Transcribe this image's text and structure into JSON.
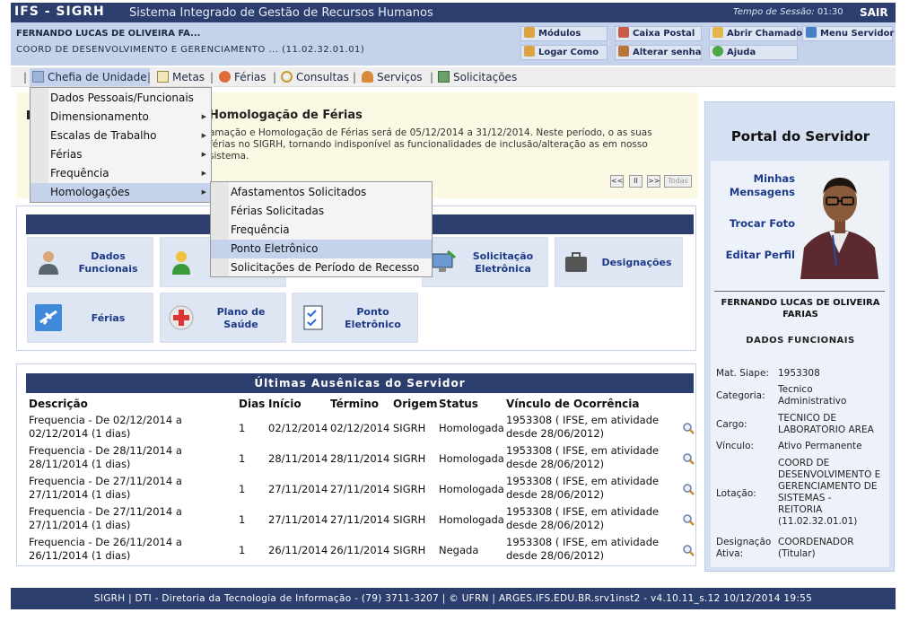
{
  "header": {
    "system_short": "IFS - SIGRH",
    "system_name": "Sistema Integrado de Gestão de Recursos Humanos",
    "session_label": "Tempo de Sessão:",
    "session_time": "01:30",
    "logout": "SAIR"
  },
  "user": {
    "name": "FERNANDO LUCAS DE OLIVEIRA FA...",
    "unit": "COORD DE DESENVOLVIMENTO E GERENCIAMENTO ... (11.02.32.01.01)"
  },
  "quick_links": {
    "modulos": "Módulos",
    "caixa_postal": "Caixa Postal",
    "abrir_chamado": "Abrir Chamado",
    "menu_servidor": "Menu Servidor",
    "logar_como": "Logar Como",
    "alterar_senha": "Alterar senha",
    "ajuda": "Ajuda"
  },
  "menu": {
    "chefia": "Chefia de Unidade",
    "metas": "Metas",
    "ferias": "Férias",
    "consultas": "Consultas",
    "servicos": "Serviços",
    "solicitacoes": "Solicitações",
    "separator": "|"
  },
  "dropdown_chefia": [
    "Dados Pessoais/Funcionais",
    "Dimensionamento",
    "Escalas de Trabalho",
    "Férias",
    "Frequência",
    "Homologações"
  ],
  "dropdown_homologacoes": [
    "Afastamentos Solicitados",
    "Férias Solicitadas",
    "Frequência",
    "Ponto Eletrônico",
    "Solicitações de Período de Recesso"
  ],
  "notice": {
    "title": "Homologação de Férias",
    "text": "amação e Homologação de Férias será de 05/12/2014 a 31/12/2014. Neste período, o as suas férias no SIGRH, tornando indisponível as funcionalidades de inclusão/alteração as em nosso sistema.",
    "pager": {
      "prev": "<<",
      "pause": "II",
      "next": ">>",
      "all": "Todas"
    }
  },
  "shortcuts": {
    "dados_funcionais": "Dados Funcionais",
    "solicitacao_eletronica": "Solicitação Eletrônica",
    "designacoes": "Designações",
    "ferias": "Férias",
    "plano_saude": "Plano de Saúde",
    "ponto_eletronico": "Ponto Eletrônico"
  },
  "absences": {
    "title": "Últimas Ausênicas do Servidor",
    "columns": [
      "Descrição",
      "Dias",
      "Início",
      "Término",
      "Origem",
      "Status",
      "Vínculo de Ocorrência"
    ],
    "rows": [
      {
        "desc1": "Frequencia - De 02/12/2014 a",
        "desc2": "02/12/2014 (1 dias)",
        "dias": "1",
        "inicio": "02/12/2014",
        "termino": "02/12/2014",
        "origem": "SIGRH",
        "status": "Homologada",
        "vinc1": "1953308 ( IFSE, em atividade",
        "vinc2": "desde 28/06/2012)"
      },
      {
        "desc1": "Frequencia - De 28/11/2014 a",
        "desc2": "28/11/2014 (1 dias)",
        "dias": "1",
        "inicio": "28/11/2014",
        "termino": "28/11/2014",
        "origem": "SIGRH",
        "status": "Homologada",
        "vinc1": "1953308 ( IFSE, em atividade",
        "vinc2": "desde 28/06/2012)"
      },
      {
        "desc1": "Frequencia - De 27/11/2014 a",
        "desc2": "27/11/2014 (1 dias)",
        "dias": "1",
        "inicio": "27/11/2014",
        "termino": "27/11/2014",
        "origem": "SIGRH",
        "status": "Homologada",
        "vinc1": "1953308 ( IFSE, em atividade",
        "vinc2": "desde 28/06/2012)"
      },
      {
        "desc1": "Frequencia - De 27/11/2014 a",
        "desc2": "27/11/2014 (1 dias)",
        "dias": "1",
        "inicio": "27/11/2014",
        "termino": "27/11/2014",
        "origem": "SIGRH",
        "status": "Homologada",
        "vinc1": "1953308 ( IFSE, em atividade",
        "vinc2": "desde 28/06/2012)"
      },
      {
        "desc1": "Frequencia - De 26/11/2014 a",
        "desc2": "26/11/2014 (1 dias)",
        "dias": "1",
        "inicio": "26/11/2014",
        "termino": "26/11/2014",
        "origem": "SIGRH",
        "status": "Negada",
        "vinc1": "1953308 ( IFSE, em atividade",
        "vinc2": "desde 28/06/2012)"
      }
    ]
  },
  "portal": {
    "title": "Portal do Servidor",
    "minhas1": "Minhas",
    "minhas2": "Mensagens",
    "trocar_foto": "Trocar Foto",
    "editar_perfil": "Editar Perfil",
    "name1": "FERNANDO LUCAS DE OLIVEIRA",
    "name2": "FARIAS",
    "dados_funcionais": "DADOS FUNCIONAIS",
    "fields": {
      "siape_label": "Mat. Siape:",
      "siape": "1953308",
      "categoria_label": "Categoria:",
      "categoria1": "Tecnico",
      "categoria2": "Administrativo",
      "cargo_label": "Cargo:",
      "cargo1": "TECNICO DE",
      "cargo2": "LABORATORIO AREA",
      "vinculo_label": "Vínculo:",
      "vinculo": "Ativo Permanente",
      "lotacao_label": "Lotação:",
      "lotacao": [
        "COORD DE",
        "DESENVOLVIMENTO E",
        "GERENCIAMENTO DE",
        "SISTEMAS -",
        "REITORIA",
        "(11.02.32.01.01)"
      ],
      "designacao_label1": "Designação",
      "designacao_label2": "Ativa:",
      "designacao1": "COORDENADOR",
      "designacao2": "(Titular)"
    }
  },
  "footer": "SIGRH | DTI - Diretoria da Tecnologia de Informação - (79) 3711-3207 | © UFRN | ARGES.IFS.EDU.BR.srv1inst2 - v4.10.11_s.12 10/12/2014 19:55",
  "colors": {
    "navy": "#2c3e6e",
    "light_blue": "#c4d2eb",
    "tile_bg": "#dfe6f3",
    "link_blue": "#1d3a88",
    "notice_bg": "#fbf8e4"
  }
}
